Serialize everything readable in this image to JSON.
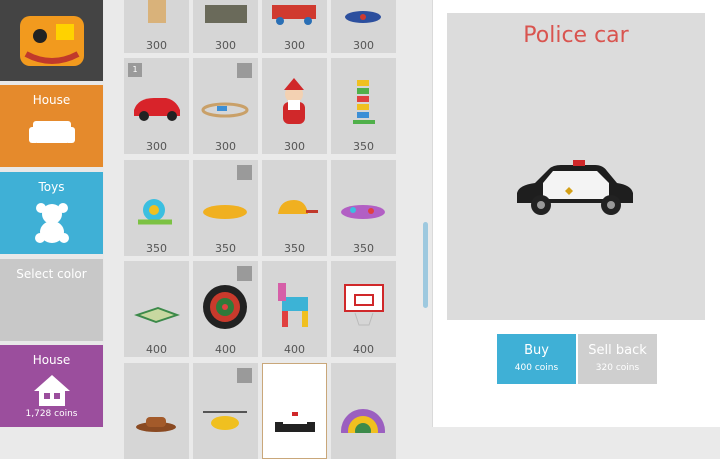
{
  "sidebar": {
    "items": [
      {
        "label": "House"
      },
      {
        "label": "Toys"
      },
      {
        "label": "Select color"
      },
      {
        "label": "House",
        "coins": "1,728 coins"
      }
    ]
  },
  "grid": {
    "rows": [
      [
        "300",
        "300",
        "300",
        "300"
      ],
      [
        "300",
        "300",
        "300",
        "350"
      ],
      [
        "350",
        "350",
        "350",
        "350"
      ],
      [
        "400",
        "400",
        "400",
        "400"
      ]
    ],
    "badge_number": "1"
  },
  "detail": {
    "title": "Police car",
    "buy_label": "Buy",
    "buy_price": "400 coins",
    "sell_label": "Sell back",
    "sell_price": "320 coins"
  }
}
